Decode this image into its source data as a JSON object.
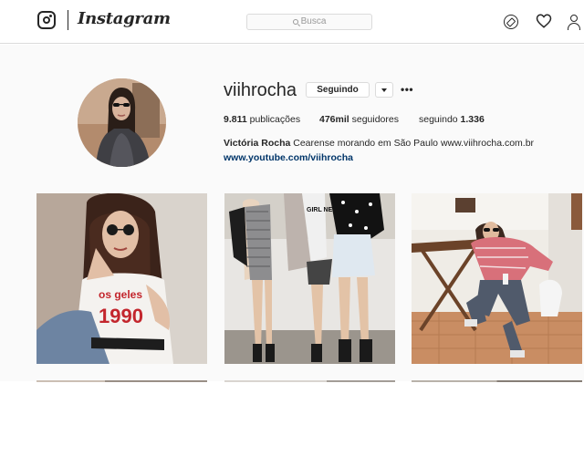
{
  "header": {
    "wordmark": "Instagram",
    "search_placeholder": "Busca",
    "icons": [
      "instagram-logo-icon",
      "compass-icon",
      "heart-icon",
      "profile-icon"
    ]
  },
  "profile": {
    "username": "viihrocha",
    "follow_label": "Seguindo",
    "more_label": "•••",
    "stats": {
      "posts_count": "9.811",
      "posts_label": " publicações",
      "followers_count": "476mil",
      "followers_label": " seguidores",
      "following_label": "seguindo ",
      "following_count": "1.336"
    },
    "full_name": "Victória Rocha",
    "bio": " Cearense morando em São Paulo www.viihrocha.com.br",
    "link": "www.youtube.com/viihrocha"
  },
  "posts": [
    {
      "shirt_text_1": "os    geles",
      "shirt_text_2": "1990"
    },
    {
      "shirt_text": "GIRL NEXT DOOR"
    },
    {}
  ],
  "colors": {
    "link": "#003569",
    "border": "#dbdbdb",
    "background": "#fafafa"
  }
}
